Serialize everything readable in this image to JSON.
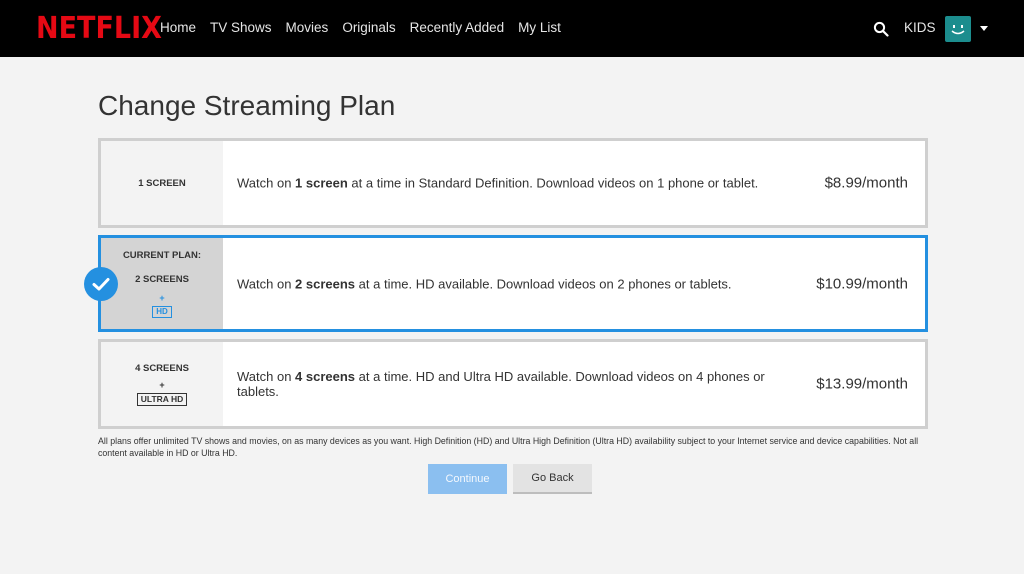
{
  "header": {
    "logo": "NETFLIX",
    "nav": [
      "Home",
      "TV Shows",
      "Movies",
      "Originals",
      "Recently Added",
      "My List"
    ],
    "kids_label": "KIDS",
    "icons": [
      "search-icon",
      "profile-avatar",
      "caret-down-icon"
    ]
  },
  "page": {
    "title": "Change Streaming Plan"
  },
  "plans": [
    {
      "screens": "1 SCREEN",
      "desc_pre": "Watch on ",
      "desc_bold": "1 screen",
      "desc_post": " at a time in Standard Definition. Download videos on 1 phone or tablet.",
      "price": "$8.99/month",
      "selected": false
    },
    {
      "current_label": "CURRENT PLAN:",
      "screens": "2 SCREENS",
      "plus": "+",
      "badge": "HD",
      "desc_pre": "Watch on ",
      "desc_bold": "2 screens",
      "desc_post": " at a time. HD available. Download videos on 2 phones or tablets.",
      "price": "$10.99/month",
      "selected": true
    },
    {
      "screens": "4 SCREENS",
      "plus": "+",
      "badge": "ULTRA HD",
      "desc_pre": "Watch on ",
      "desc_bold": "4 screens",
      "desc_post": " at a time. HD and Ultra HD available. Download videos on 4 phones or tablets.",
      "price": "$13.99/month",
      "selected": false
    }
  ],
  "fineprint": "All plans offer unlimited TV shows and movies, on as many devices as you want. High Definition (HD) and Ultra High Definition (Ultra HD) availability subject to your Internet service and device capabilities. Not all content available in HD or Ultra HD.",
  "buttons": {
    "continue": "Continue",
    "go_back": "Go Back"
  },
  "colors": {
    "brand": "#e50914",
    "accent": "#2490e0",
    "header_bg": "#000000",
    "page_bg": "#f3f3f3"
  }
}
